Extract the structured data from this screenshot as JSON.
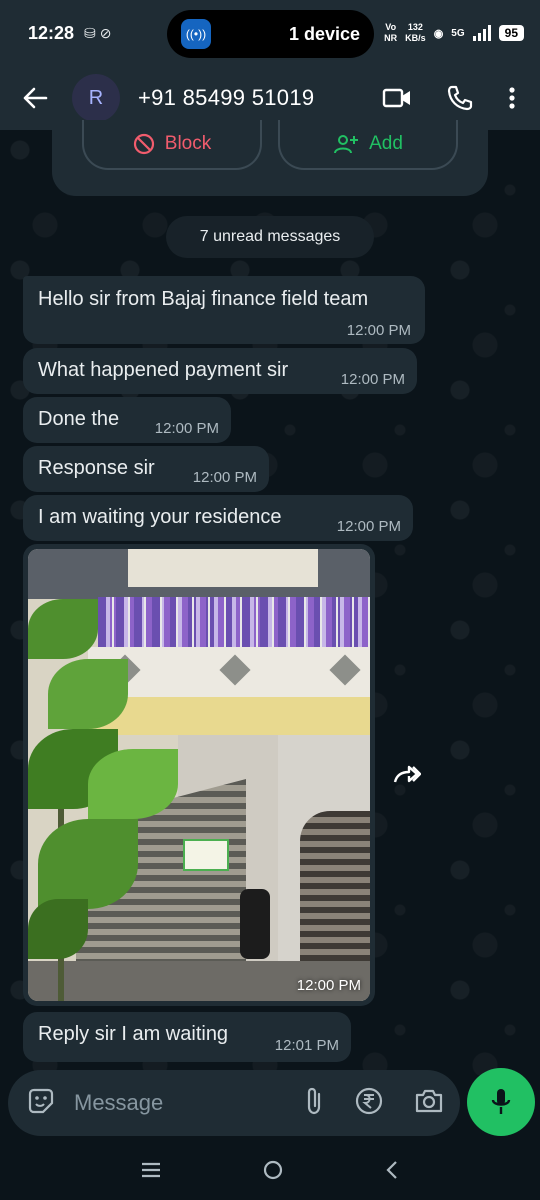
{
  "status_bar": {
    "time": "12:28",
    "island_label": "1 device",
    "network_top": "Vo",
    "network_bottom": "NR",
    "speed_value": "132",
    "speed_unit": "KB/s",
    "signal_type": "5G",
    "battery": "95"
  },
  "header": {
    "avatar_letter": "R",
    "contact_name": "+91 85499 51019"
  },
  "actions": {
    "block_label": "Block",
    "add_label": "Add"
  },
  "unread_label": "7 unread messages",
  "messages": [
    {
      "text": "Hello sir from Bajaj finance field team",
      "time": "12:00 PM"
    },
    {
      "text": "What happened payment sir",
      "time": "12:00 PM"
    },
    {
      "text": "Done the",
      "time": "12:00 PM"
    },
    {
      "text": "Response sir",
      "time": "12:00 PM"
    },
    {
      "text": "I am waiting your residence",
      "time": "12:00 PM"
    },
    {
      "text": "",
      "time": "12:00 PM"
    },
    {
      "text": "Reply sir I am waiting",
      "time": "12:01 PM"
    }
  ],
  "composer": {
    "placeholder": "Message"
  },
  "colors": {
    "accent": "#21c063",
    "danger": "#f15c6d",
    "bubble": "#1f2c34",
    "background": "#0b141a"
  }
}
